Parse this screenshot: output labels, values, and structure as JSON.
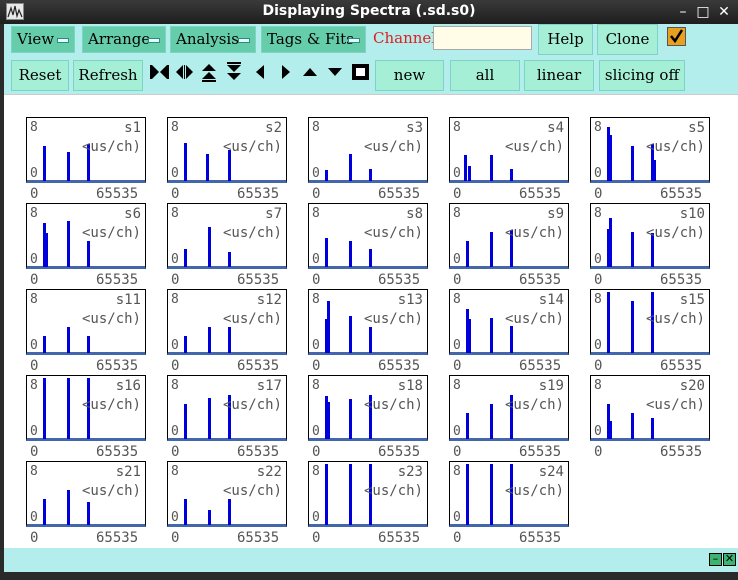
{
  "window": {
    "title": "Displaying Spectra (.sd.s0)",
    "controls": [
      "–",
      "□",
      "✕"
    ]
  },
  "toolbar": {
    "menus": [
      "View",
      "Arrange",
      "Analysis",
      "Tags & Fits"
    ],
    "channel_label": "Channel:",
    "channel_value": "",
    "help": "Help",
    "clone": "Clone",
    "reset": "Reset",
    "refresh": "Refresh",
    "new": "new",
    "all": "all",
    "scale": "linear",
    "slicing": "slicing off",
    "icons": [
      "expand-horizontal-icon",
      "contract-horizontal-icon",
      "expand-vertical-icon",
      "contract-vertical-icon",
      "left-icon",
      "right-icon",
      "up-icon",
      "down-icon",
      "stop-icon"
    ],
    "accent_color": "#66cdaa",
    "check_color": "#e8a020"
  },
  "spectra_common": {
    "xmin": "0",
    "xmax": "65535",
    "unit": "<us/ch)",
    "ymax": "8",
    "ymin": "0",
    "line_color": "#0000dd"
  },
  "spectra": [
    {
      "name": "s1",
      "peaks": [
        [
          0.13,
          0.58
        ],
        [
          0.33,
          0.47
        ],
        [
          0.5,
          0.6
        ]
      ]
    },
    {
      "name": "s2",
      "peaks": [
        [
          0.13,
          0.62
        ],
        [
          0.32,
          0.45
        ],
        [
          0.5,
          0.5
        ]
      ]
    },
    {
      "name": "s3",
      "peaks": [
        [
          0.13,
          0.18
        ],
        [
          0.33,
          0.45
        ],
        [
          0.5,
          0.2
        ]
      ]
    },
    {
      "name": "s4",
      "peaks": [
        [
          0.12,
          0.42
        ],
        [
          0.15,
          0.25
        ],
        [
          0.33,
          0.42
        ],
        [
          0.5,
          0.2
        ]
      ]
    },
    {
      "name": "s5",
      "peaks": [
        [
          0.13,
          0.88
        ],
        [
          0.15,
          0.75
        ],
        [
          0.33,
          0.58
        ],
        [
          0.5,
          0.6
        ],
        [
          0.52,
          0.35
        ]
      ]
    },
    {
      "name": "s6",
      "peaks": [
        [
          0.13,
          0.72
        ],
        [
          0.15,
          0.55
        ],
        [
          0.33,
          0.75
        ],
        [
          0.5,
          0.42
        ]
      ]
    },
    {
      "name": "s7",
      "peaks": [
        [
          0.13,
          0.3
        ],
        [
          0.33,
          0.65
        ],
        [
          0.5,
          0.25
        ]
      ]
    },
    {
      "name": "s8",
      "peaks": [
        [
          0.13,
          0.48
        ],
        [
          0.33,
          0.42
        ],
        [
          0.5,
          0.3
        ]
      ]
    },
    {
      "name": "s9",
      "peaks": [
        [
          0.13,
          0.42
        ],
        [
          0.33,
          0.58
        ],
        [
          0.5,
          0.6
        ]
      ]
    },
    {
      "name": "s10",
      "peaks": [
        [
          0.13,
          0.62
        ],
        [
          0.15,
          0.8
        ],
        [
          0.33,
          0.58
        ],
        [
          0.5,
          0.55
        ]
      ]
    },
    {
      "name": "s11",
      "peaks": [
        [
          0.13,
          0.28
        ],
        [
          0.33,
          0.42
        ],
        [
          0.5,
          0.28
        ]
      ]
    },
    {
      "name": "s12",
      "peaks": [
        [
          0.13,
          0.28
        ],
        [
          0.33,
          0.42
        ],
        [
          0.5,
          0.42
        ]
      ]
    },
    {
      "name": "s13",
      "peaks": [
        [
          0.13,
          0.55
        ],
        [
          0.15,
          0.85
        ],
        [
          0.33,
          0.6
        ],
        [
          0.5,
          0.42
        ]
      ]
    },
    {
      "name": "s14",
      "peaks": [
        [
          0.13,
          0.72
        ],
        [
          0.15,
          0.55
        ],
        [
          0.33,
          0.58
        ],
        [
          0.5,
          0.45
        ]
      ]
    },
    {
      "name": "s15",
      "peaks": [
        [
          0.13,
          1.0
        ],
        [
          0.33,
          0.85
        ],
        [
          0.5,
          1.0
        ]
      ]
    },
    {
      "name": "s16",
      "peaks": [
        [
          0.13,
          1.0
        ],
        [
          0.33,
          1.0
        ],
        [
          0.5,
          1.0
        ]
      ]
    },
    {
      "name": "s17",
      "peaks": [
        [
          0.13,
          0.58
        ],
        [
          0.33,
          0.68
        ],
        [
          0.5,
          0.72
        ]
      ]
    },
    {
      "name": "s18",
      "peaks": [
        [
          0.13,
          0.7
        ],
        [
          0.15,
          0.6
        ],
        [
          0.33,
          0.65
        ],
        [
          0.5,
          0.72
        ]
      ]
    },
    {
      "name": "s19",
      "peaks": [
        [
          0.13,
          0.42
        ],
        [
          0.33,
          0.58
        ],
        [
          0.5,
          0.72
        ]
      ]
    },
    {
      "name": "s20",
      "peaks": [
        [
          0.13,
          0.58
        ],
        [
          0.15,
          0.3
        ],
        [
          0.33,
          0.42
        ],
        [
          0.5,
          0.35
        ]
      ]
    },
    {
      "name": "s21",
      "peaks": [
        [
          0.13,
          0.42
        ],
        [
          0.33,
          0.58
        ],
        [
          0.5,
          0.38
        ]
      ]
    },
    {
      "name": "s22",
      "peaks": [
        [
          0.13,
          0.42
        ],
        [
          0.33,
          0.25
        ],
        [
          0.5,
          0.42
        ]
      ]
    },
    {
      "name": "s23",
      "peaks": [
        [
          0.13,
          1.0
        ],
        [
          0.33,
          1.0
        ],
        [
          0.5,
          1.0
        ]
      ]
    },
    {
      "name": "s24",
      "peaks": [
        [
          0.13,
          1.0
        ],
        [
          0.33,
          1.0
        ],
        [
          0.5,
          1.0
        ]
      ]
    }
  ]
}
